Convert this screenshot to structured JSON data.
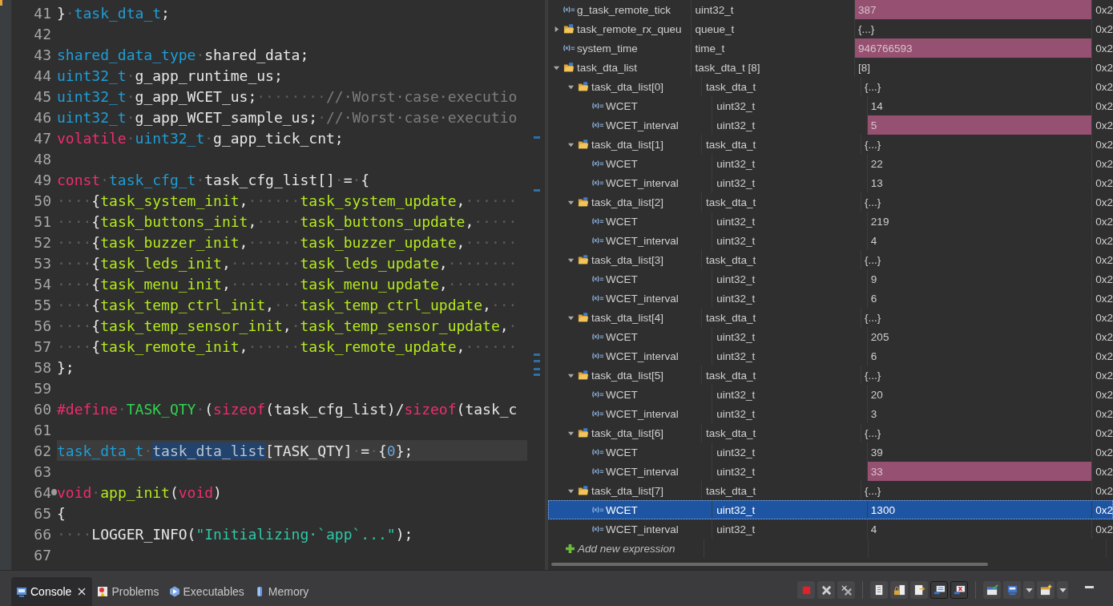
{
  "editor": {
    "lines": [
      {
        "number": "41",
        "current": false,
        "fold": false,
        "tokens": [
          {
            "kind": "plain",
            "text": "}"
          },
          {
            "kind": "ws",
            "text": "·"
          },
          {
            "kind": "type",
            "text": "task_dta_t"
          },
          {
            "kind": "plain",
            "text": ";"
          }
        ]
      },
      {
        "number": "42",
        "current": false,
        "fold": false
      },
      {
        "number": "43",
        "current": false,
        "fold": false,
        "tokens": [
          {
            "kind": "type",
            "text": "shared_data_type"
          },
          {
            "kind": "ws",
            "text": "·"
          },
          {
            "kind": "plain",
            "text": "shared_data;"
          }
        ]
      },
      {
        "number": "44",
        "current": false,
        "fold": false,
        "tokens": [
          {
            "kind": "type",
            "text": "uint32_t"
          },
          {
            "kind": "ws",
            "text": "·"
          },
          {
            "kind": "plain",
            "text": "g_app_runtime_us;"
          }
        ]
      },
      {
        "number": "45",
        "current": false,
        "fold": false,
        "tokens": [
          {
            "kind": "type",
            "text": "uint32_t"
          },
          {
            "kind": "ws",
            "text": "·"
          },
          {
            "kind": "plain",
            "text": "g_app_WCET_us;"
          },
          {
            "kind": "ws",
            "text": "········"
          },
          {
            "kind": "comment",
            "text": "//·Worst·case·executio"
          }
        ]
      },
      {
        "number": "46",
        "current": false,
        "fold": false,
        "tokens": [
          {
            "kind": "type",
            "text": "uint32_t"
          },
          {
            "kind": "ws",
            "text": "·"
          },
          {
            "kind": "plain",
            "text": "g_app_WCET_sample_us;"
          },
          {
            "kind": "ws",
            "text": "·"
          },
          {
            "kind": "comment",
            "text": "//·Worst·case·executio"
          }
        ]
      },
      {
        "number": "47",
        "current": false,
        "fold": false,
        "tokens": [
          {
            "kind": "keyword",
            "text": "volatile"
          },
          {
            "kind": "ws",
            "text": "·"
          },
          {
            "kind": "type",
            "text": "uint32_t"
          },
          {
            "kind": "ws",
            "text": "·"
          },
          {
            "kind": "plain",
            "text": "g_app_tick_cnt;"
          }
        ]
      },
      {
        "number": "48",
        "current": false,
        "fold": false
      },
      {
        "number": "49",
        "current": false,
        "fold": false,
        "tokens": [
          {
            "kind": "keyword",
            "text": "const"
          },
          {
            "kind": "ws",
            "text": "·"
          },
          {
            "kind": "type",
            "text": "task_cfg_t"
          },
          {
            "kind": "ws",
            "text": "·"
          },
          {
            "kind": "plain",
            "text": "task_cfg_list[]"
          },
          {
            "kind": "ws",
            "text": "·"
          },
          {
            "kind": "plain",
            "text": "="
          },
          {
            "kind": "ws",
            "text": "·"
          },
          {
            "kind": "plain",
            "text": "{"
          }
        ]
      },
      {
        "number": "50",
        "current": false,
        "fold": false,
        "tokens": [
          {
            "kind": "ws",
            "text": "····"
          },
          {
            "kind": "plain",
            "text": "{"
          },
          {
            "kind": "function",
            "text": "task_system_init"
          },
          {
            "kind": "plain",
            "text": ","
          },
          {
            "kind": "ws",
            "text": "······"
          },
          {
            "kind": "function",
            "text": "task_system_update"
          },
          {
            "kind": "plain",
            "text": ","
          },
          {
            "kind": "ws",
            "text": "······"
          }
        ]
      },
      {
        "number": "51",
        "current": false,
        "fold": false,
        "tokens": [
          {
            "kind": "ws",
            "text": "····"
          },
          {
            "kind": "plain",
            "text": "{"
          },
          {
            "kind": "function",
            "text": "task_buttons_init"
          },
          {
            "kind": "plain",
            "text": ","
          },
          {
            "kind": "ws",
            "text": "·····"
          },
          {
            "kind": "function",
            "text": "task_buttons_update"
          },
          {
            "kind": "plain",
            "text": ","
          },
          {
            "kind": "ws",
            "text": "·····"
          }
        ]
      },
      {
        "number": "52",
        "current": false,
        "fold": false,
        "tokens": [
          {
            "kind": "ws",
            "text": "····"
          },
          {
            "kind": "plain",
            "text": "{"
          },
          {
            "kind": "function",
            "text": "task_buzzer_init"
          },
          {
            "kind": "plain",
            "text": ","
          },
          {
            "kind": "ws",
            "text": "······"
          },
          {
            "kind": "function",
            "text": "task_buzzer_update"
          },
          {
            "kind": "plain",
            "text": ","
          },
          {
            "kind": "ws",
            "text": "······"
          }
        ]
      },
      {
        "number": "53",
        "current": false,
        "fold": false,
        "tokens": [
          {
            "kind": "ws",
            "text": "····"
          },
          {
            "kind": "plain",
            "text": "{"
          },
          {
            "kind": "function",
            "text": "task_leds_init"
          },
          {
            "kind": "plain",
            "text": ","
          },
          {
            "kind": "ws",
            "text": "········"
          },
          {
            "kind": "function",
            "text": "task_leds_update"
          },
          {
            "kind": "plain",
            "text": ","
          },
          {
            "kind": "ws",
            "text": "········"
          }
        ]
      },
      {
        "number": "54",
        "current": false,
        "fold": false,
        "tokens": [
          {
            "kind": "ws",
            "text": "····"
          },
          {
            "kind": "plain",
            "text": "{"
          },
          {
            "kind": "function",
            "text": "task_menu_init"
          },
          {
            "kind": "plain",
            "text": ","
          },
          {
            "kind": "ws",
            "text": "········"
          },
          {
            "kind": "function",
            "text": "task_menu_update"
          },
          {
            "kind": "plain",
            "text": ","
          },
          {
            "kind": "ws",
            "text": "········"
          }
        ]
      },
      {
        "number": "55",
        "current": false,
        "fold": false,
        "tokens": [
          {
            "kind": "ws",
            "text": "····"
          },
          {
            "kind": "plain",
            "text": "{"
          },
          {
            "kind": "function",
            "text": "task_temp_ctrl_init"
          },
          {
            "kind": "plain",
            "text": ","
          },
          {
            "kind": "ws",
            "text": "···"
          },
          {
            "kind": "function",
            "text": "task_temp_ctrl_update"
          },
          {
            "kind": "plain",
            "text": ","
          },
          {
            "kind": "ws",
            "text": "···"
          }
        ]
      },
      {
        "number": "56",
        "current": false,
        "fold": false,
        "tokens": [
          {
            "kind": "ws",
            "text": "····"
          },
          {
            "kind": "plain",
            "text": "{"
          },
          {
            "kind": "function",
            "text": "task_temp_sensor_init"
          },
          {
            "kind": "plain",
            "text": ","
          },
          {
            "kind": "ws",
            "text": "·"
          },
          {
            "kind": "function",
            "text": "task_temp_sensor_update"
          },
          {
            "kind": "plain",
            "text": ","
          },
          {
            "kind": "ws",
            "text": "·"
          }
        ]
      },
      {
        "number": "57",
        "current": false,
        "fold": false,
        "tokens": [
          {
            "kind": "ws",
            "text": "····"
          },
          {
            "kind": "plain",
            "text": "{"
          },
          {
            "kind": "function",
            "text": "task_remote_init"
          },
          {
            "kind": "plain",
            "text": ","
          },
          {
            "kind": "ws",
            "text": "······"
          },
          {
            "kind": "function",
            "text": "task_remote_update"
          },
          {
            "kind": "plain",
            "text": ","
          },
          {
            "kind": "ws",
            "text": "······"
          }
        ]
      },
      {
        "number": "58",
        "current": false,
        "fold": false,
        "tokens": [
          {
            "kind": "plain",
            "text": "};"
          }
        ]
      },
      {
        "number": "59",
        "current": false,
        "fold": false
      },
      {
        "number": "60",
        "current": false,
        "fold": false,
        "tokens": [
          {
            "kind": "keyword",
            "text": "#define"
          },
          {
            "kind": "ws",
            "text": "·"
          },
          {
            "kind": "macro",
            "text": "TASK_QTY"
          },
          {
            "kind": "ws",
            "text": "·"
          },
          {
            "kind": "plain",
            "text": "("
          },
          {
            "kind": "keyword",
            "text": "sizeof"
          },
          {
            "kind": "plain",
            "text": "(task_cfg_list)/"
          },
          {
            "kind": "keyword",
            "text": "sizeof"
          },
          {
            "kind": "plain",
            "text": "(task_c"
          }
        ]
      },
      {
        "number": "61",
        "current": false,
        "fold": false
      },
      {
        "number": "62",
        "current": true,
        "fold": false,
        "tokens": [
          {
            "kind": "type",
            "text": "task_dta_t"
          },
          {
            "kind": "ws",
            "text": "·"
          },
          {
            "kind": "selection",
            "text": "task_dta_list"
          },
          {
            "kind": "plain",
            "text": "[TASK_QTY]"
          },
          {
            "kind": "ws",
            "text": "·"
          },
          {
            "kind": "plain",
            "text": "="
          },
          {
            "kind": "ws",
            "text": "·"
          },
          {
            "kind": "plain",
            "text": "{"
          },
          {
            "kind": "number",
            "text": "0"
          },
          {
            "kind": "plain",
            "text": "};"
          }
        ]
      },
      {
        "number": "63",
        "current": false,
        "fold": false
      },
      {
        "number": "64",
        "current": false,
        "fold": true,
        "tokens": [
          {
            "kind": "keyword",
            "text": "void"
          },
          {
            "kind": "ws",
            "text": "·"
          },
          {
            "kind": "function",
            "text": "app_init"
          },
          {
            "kind": "plain",
            "text": "("
          },
          {
            "kind": "keyword",
            "text": "void"
          },
          {
            "kind": "plain",
            "text": ")"
          }
        ]
      },
      {
        "number": "65",
        "current": false,
        "fold": false,
        "tokens": [
          {
            "kind": "plain",
            "text": "{"
          }
        ]
      },
      {
        "number": "66",
        "current": false,
        "fold": false,
        "tokens": [
          {
            "kind": "ws",
            "text": "····"
          },
          {
            "kind": "plain",
            "text": "LOGGER_INFO("
          },
          {
            "kind": "string",
            "text": "\"Initializing·`app`...\""
          },
          {
            "kind": "plain",
            "text": ");"
          }
        ]
      },
      {
        "number": "67",
        "current": false,
        "fold": false
      }
    ]
  },
  "expressions": {
    "rows": [
      {
        "name": "g_task_remote_tick",
        "type": "uint32_t",
        "value": "387",
        "address": "0x2",
        "kind": "variable",
        "changed": true,
        "selected": false
      },
      {
        "name": "task_remote_rx_queu",
        "type": "queue_t",
        "value": "{...}",
        "address": "0x2",
        "kind": "struct",
        "expanded": false,
        "changed": false,
        "selected": false
      },
      {
        "name": "system_time",
        "type": "time_t",
        "value": "946766593",
        "address": "0x2",
        "kind": "variable",
        "changed": true,
        "selected": false
      },
      {
        "name": "task_dta_list",
        "type": "task_dta_t [8]",
        "value": "[8]",
        "address": "0x2",
        "kind": "struct",
        "expanded": true,
        "changed": false,
        "selected": false,
        "children": [
          {
            "name": "task_dta_list[0]",
            "type": "task_dta_t",
            "value": "{...}",
            "address": "0x2",
            "kind": "struct",
            "expanded": true,
            "changed": false,
            "selected": false,
            "children": [
              {
                "name": "WCET",
                "type": "uint32_t",
                "value": "14",
                "address": "0x2",
                "kind": "variable",
                "changed": false,
                "selected": false
              },
              {
                "name": "WCET_interval",
                "type": "uint32_t",
                "value": "5",
                "address": "0x2",
                "kind": "variable",
                "changed": true,
                "selected": false
              }
            ]
          },
          {
            "name": "task_dta_list[1]",
            "type": "task_dta_t",
            "value": "{...}",
            "address": "0x2",
            "kind": "struct",
            "expanded": true,
            "changed": false,
            "selected": false,
            "children": [
              {
                "name": "WCET",
                "type": "uint32_t",
                "value": "22",
                "address": "0x2",
                "kind": "variable",
                "changed": false,
                "selected": false
              },
              {
                "name": "WCET_interval",
                "type": "uint32_t",
                "value": "13",
                "address": "0x2",
                "kind": "variable",
                "changed": false,
                "selected": false
              }
            ]
          },
          {
            "name": "task_dta_list[2]",
            "type": "task_dta_t",
            "value": "{...}",
            "address": "0x2",
            "kind": "struct",
            "expanded": true,
            "changed": false,
            "selected": false,
            "children": [
              {
                "name": "WCET",
                "type": "uint32_t",
                "value": "219",
                "address": "0x2",
                "kind": "variable",
                "changed": false,
                "selected": false
              },
              {
                "name": "WCET_interval",
                "type": "uint32_t",
                "value": "4",
                "address": "0x2",
                "kind": "variable",
                "changed": false,
                "selected": false
              }
            ]
          },
          {
            "name": "task_dta_list[3]",
            "type": "task_dta_t",
            "value": "{...}",
            "address": "0x2",
            "kind": "struct",
            "expanded": true,
            "changed": false,
            "selected": false,
            "children": [
              {
                "name": "WCET",
                "type": "uint32_t",
                "value": "9",
                "address": "0x2",
                "kind": "variable",
                "changed": false,
                "selected": false
              },
              {
                "name": "WCET_interval",
                "type": "uint32_t",
                "value": "6",
                "address": "0x2",
                "kind": "variable",
                "changed": false,
                "selected": false
              }
            ]
          },
          {
            "name": "task_dta_list[4]",
            "type": "task_dta_t",
            "value": "{...}",
            "address": "0x2",
            "kind": "struct",
            "expanded": true,
            "changed": false,
            "selected": false,
            "children": [
              {
                "name": "WCET",
                "type": "uint32_t",
                "value": "205",
                "address": "0x2",
                "kind": "variable",
                "changed": false,
                "selected": false
              },
              {
                "name": "WCET_interval",
                "type": "uint32_t",
                "value": "6",
                "address": "0x2",
                "kind": "variable",
                "changed": false,
                "selected": false
              }
            ]
          },
          {
            "name": "task_dta_list[5]",
            "type": "task_dta_t",
            "value": "{...}",
            "address": "0x2",
            "kind": "struct",
            "expanded": true,
            "changed": false,
            "selected": false,
            "children": [
              {
                "name": "WCET",
                "type": "uint32_t",
                "value": "20",
                "address": "0x2",
                "kind": "variable",
                "changed": false,
                "selected": false
              },
              {
                "name": "WCET_interval",
                "type": "uint32_t",
                "value": "3",
                "address": "0x2",
                "kind": "variable",
                "changed": false,
                "selected": false
              }
            ]
          },
          {
            "name": "task_dta_list[6]",
            "type": "task_dta_t",
            "value": "{...}",
            "address": "0x2",
            "kind": "struct",
            "expanded": true,
            "changed": false,
            "selected": false,
            "children": [
              {
                "name": "WCET",
                "type": "uint32_t",
                "value": "39",
                "address": "0x2",
                "kind": "variable",
                "changed": false,
                "selected": false
              },
              {
                "name": "WCET_interval",
                "type": "uint32_t",
                "value": "33",
                "address": "0x2",
                "kind": "variable",
                "changed": true,
                "selected": false
              }
            ]
          },
          {
            "name": "task_dta_list[7]",
            "type": "task_dta_t",
            "value": "{...}",
            "address": "0x2",
            "kind": "struct",
            "expanded": true,
            "changed": false,
            "selected": false,
            "children": [
              {
                "name": "WCET",
                "type": "uint32_t",
                "value": "1300",
                "address": "0x2",
                "kind": "variable",
                "changed": false,
                "selected": true
              },
              {
                "name": "WCET_interval",
                "type": "uint32_t",
                "value": "4",
                "address": "0x2",
                "kind": "variable",
                "changed": false,
                "selected": false
              }
            ]
          }
        ]
      }
    ],
    "add_label": "Add new expression"
  },
  "bottom_tabs": [
    {
      "label": "Console",
      "kind": "console",
      "selected": true,
      "closable": true
    },
    {
      "label": "Problems",
      "kind": "problems",
      "selected": false,
      "closable": false
    },
    {
      "label": "Executables",
      "kind": "executables",
      "selected": false,
      "closable": false
    },
    {
      "label": "Memory",
      "kind": "memory",
      "selected": false,
      "closable": false
    }
  ],
  "toolbar": [
    {
      "kind": "stop",
      "pressed": false,
      "dropdown": false
    },
    {
      "kind": "remove",
      "pressed": false,
      "dropdown": false
    },
    {
      "kind": "remove-all",
      "pressed": false,
      "dropdown": false
    },
    {
      "kind": "doc",
      "pressed": false,
      "dropdown": false
    },
    {
      "kind": "lock",
      "pressed": false,
      "dropdown": false
    },
    {
      "kind": "doc-arrow",
      "pressed": false,
      "dropdown": false
    },
    {
      "kind": "pin",
      "pressed": true,
      "dropdown": false
    },
    {
      "kind": "pin-error",
      "pressed": true,
      "dropdown": false
    },
    {
      "kind": "display",
      "pressed": false,
      "dropdown": false
    },
    {
      "kind": "monitor",
      "pressed": false,
      "dropdown": true
    },
    {
      "kind": "new",
      "pressed": false,
      "dropdown": true
    }
  ]
}
